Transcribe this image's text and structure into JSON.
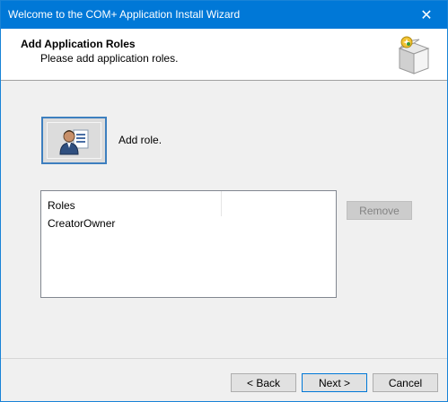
{
  "window": {
    "title": "Welcome to the COM+ Application Install Wizard",
    "close_glyph": "✕"
  },
  "header": {
    "title": "Add Application Roles",
    "subtitle": "Please add application roles.",
    "icon": "install-package-icon"
  },
  "add_role": {
    "icon": "user-role-icon",
    "label": "Add role."
  },
  "roles_list": {
    "columns": [
      "Roles"
    ],
    "rows": [
      "CreatorOwner"
    ]
  },
  "buttons": {
    "remove": "Remove",
    "back": "< Back",
    "next": "Next >",
    "cancel": "Cancel"
  },
  "colors": {
    "titlebar": "#0078d7",
    "focus_border": "#3d7fbf"
  }
}
